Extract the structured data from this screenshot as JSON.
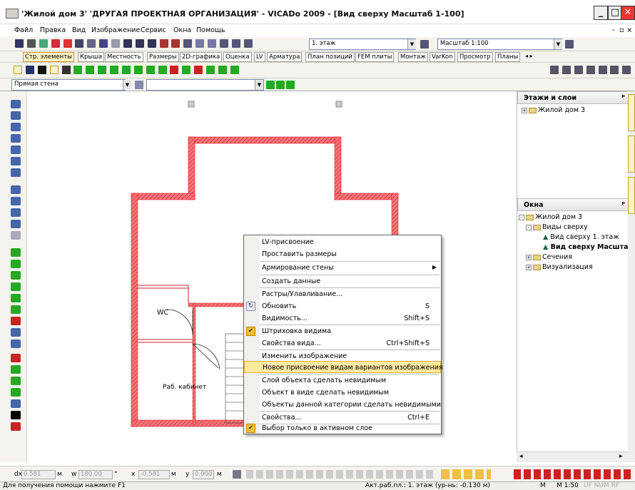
{
  "window": {
    "title": "'Жилой дом 3' 'ДРУГАЯ ПРОЕКТНАЯ ОРГАНИЗАЦИЯ' - VICADo 2009 - [Вид сверху Масштаб 1-100]"
  },
  "menu": {
    "items": [
      "Файл",
      "Правка",
      "Вид",
      "Изображение",
      "Сервис",
      "Окна",
      "Помощь"
    ]
  },
  "toolbar1": {
    "floor_value": "1. этаж",
    "scale_value": "Масштаб 1:100"
  },
  "tabs": [
    "Стр. элементы",
    "Крыша",
    "Местность",
    "Размеры",
    "2D-графика",
    "Оценка",
    "LV",
    "Арматура",
    "План позиций",
    "FEM плиты",
    "Монтаж",
    "VarKon",
    "Просмотр",
    "Планы"
  ],
  "toolbar3": {
    "element_type": "Прямая стена"
  },
  "drawing": {
    "rooms": [
      {
        "label": "WC"
      },
      {
        "label": "Раб. кабинет"
      }
    ]
  },
  "panel_layers": {
    "title": "Этажи и слои",
    "items": [
      "Жилой дом 3"
    ]
  },
  "panel_windows": {
    "title": "Окна",
    "items": [
      "Жилой дом 3",
      "Виды сверху",
      "Вид сверху 1. этаж",
      "Вид сверху Масштаб 1-",
      "Сечения",
      "Визуализация"
    ]
  },
  "side_tabs": [
    "Слоёв",
    "Каталог",
    "Свойства"
  ],
  "context_menu": {
    "items": [
      {
        "label": "LV-присвоение",
        "shortcut": ""
      },
      {
        "label": "Проставить размеры",
        "shortcut": ""
      },
      {
        "label": "Армирование стены",
        "shortcut": ""
      },
      {
        "label": "Создать данные",
        "shortcut": ""
      },
      {
        "label": "Растры/Улавливание...",
        "shortcut": ""
      },
      {
        "label": "Обновить",
        "shortcut": "S"
      },
      {
        "label": "Видимость...",
        "shortcut": "Shift+S"
      },
      {
        "label": "Штриховка видима",
        "shortcut": ""
      },
      {
        "label": "Свойства вида...",
        "shortcut": "Ctrl+Shift+S"
      },
      {
        "label": "Изменить изображение",
        "shortcut": ""
      },
      {
        "label": "Новое присвоение видам вариантов изображения",
        "shortcut": ""
      },
      {
        "label": "Слой объекта сделать невидимым",
        "shortcut": ""
      },
      {
        "label": "Объект в виде сделать невидимым",
        "shortcut": ""
      },
      {
        "label": "Объекты данной категории сделать невидимыми",
        "shortcut": ""
      },
      {
        "label": "Свойства...",
        "shortcut": "Ctrl+E"
      },
      {
        "label": "Выбор только в активном слое",
        "shortcut": ""
      }
    ]
  },
  "coords": {
    "dx_label": "dx",
    "dx_value": "0.581",
    "dx_unit": "м",
    "w_label": "w",
    "w_value": "180.00",
    "w_unit": "°",
    "x_label": "x",
    "x_value": "-0.581",
    "x_unit": "м",
    "y_label": "y",
    "y_value": "0.000",
    "y_unit": "м"
  },
  "status": {
    "help": "Для получения помощи нажмите F1",
    "active_plane": "Акт.раб.пл.: 1. этаж (ур-нь: -0.130 м)",
    "mode": "M",
    "scale": "M 1:50",
    "indicators": "UF   NUM   RF"
  },
  "colors": {
    "wall": "#e8333a",
    "menu_highlight": "#fde8a0",
    "check": "#f0c040"
  }
}
